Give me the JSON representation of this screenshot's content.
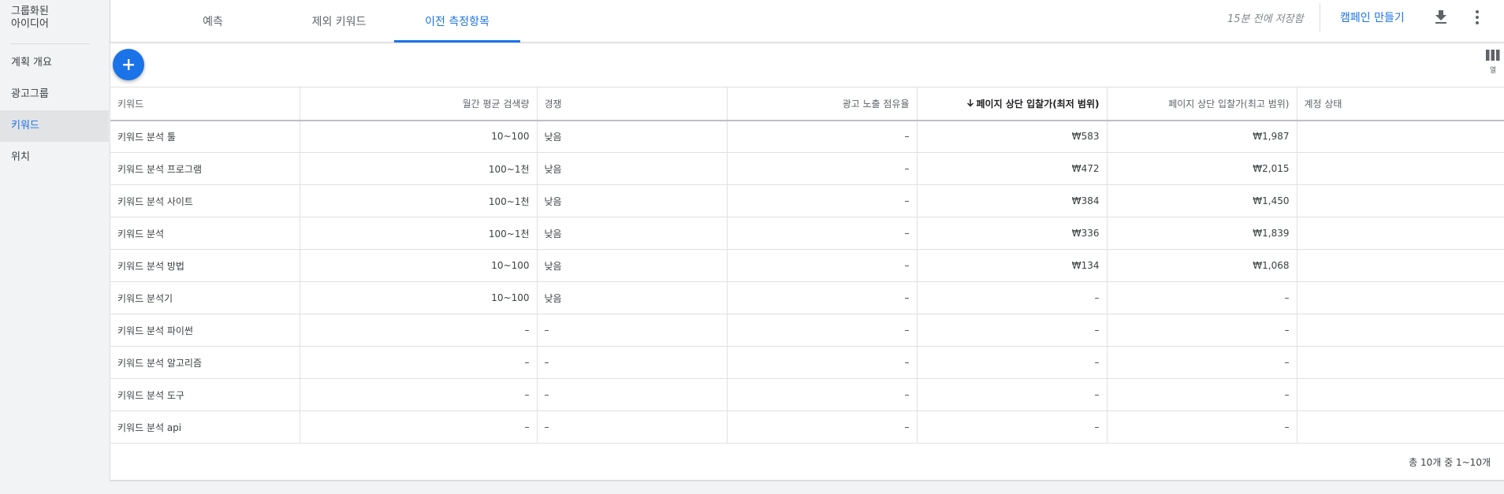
{
  "sidebar": {
    "group_title_line1": "그룹화된",
    "group_title_line2": "아이디어",
    "items": [
      {
        "label": "계획 개요",
        "active": false
      },
      {
        "label": "광고그룹",
        "active": false
      },
      {
        "label": "키워드",
        "active": true
      },
      {
        "label": "위치",
        "active": false
      }
    ]
  },
  "tabs": [
    {
      "label": "예측",
      "active": false
    },
    {
      "label": "제외 키워드",
      "active": false
    },
    {
      "label": "이전 측정항목",
      "active": true
    }
  ],
  "header": {
    "saved_status": "15분 전에 저장함",
    "create_campaign_label": "캠페인 만들기",
    "download_icon": "download-icon",
    "more_icon": "more-vert-icon"
  },
  "toolbar": {
    "add_icon": "plus-icon",
    "columns_label": "열"
  },
  "table": {
    "columns": [
      {
        "label": "키워드",
        "align": "left"
      },
      {
        "label": "월간 평균 검색량",
        "align": "right"
      },
      {
        "label": "경쟁",
        "align": "left"
      },
      {
        "label": "광고 노출 점유율",
        "align": "right"
      },
      {
        "label": "페이지 상단 입찰가(최저 범위)",
        "align": "right",
        "sorted": "desc"
      },
      {
        "label": "페이지 상단 입찰가(최고 범위)",
        "align": "right"
      },
      {
        "label": "계정 상태",
        "align": "left"
      }
    ],
    "rows": [
      [
        "키워드 분석 툴",
        "10~100",
        "낮음",
        "–",
        "₩583",
        "₩1,987",
        ""
      ],
      [
        "키워드 분석 프로그램",
        "100~1천",
        "낮음",
        "–",
        "₩472",
        "₩2,015",
        ""
      ],
      [
        "키워드 분석 사이트",
        "100~1천",
        "낮음",
        "–",
        "₩384",
        "₩1,450",
        ""
      ],
      [
        "키워드 분석",
        "100~1천",
        "낮음",
        "–",
        "₩336",
        "₩1,839",
        ""
      ],
      [
        "키워드 분석 방법",
        "10~100",
        "낮음",
        "–",
        "₩134",
        "₩1,068",
        ""
      ],
      [
        "키워드 분석기",
        "10~100",
        "낮음",
        "–",
        "–",
        "–",
        ""
      ],
      [
        "키워드 분석 파이썬",
        "–",
        "–",
        "–",
        "–",
        "–",
        ""
      ],
      [
        "키워드 분석 알고리즘",
        "–",
        "–",
        "–",
        "–",
        "–",
        ""
      ],
      [
        "키워드 분석 도구",
        "–",
        "–",
        "–",
        "–",
        "–",
        ""
      ],
      [
        "키워드 분석 api",
        "–",
        "–",
        "–",
        "–",
        "–",
        ""
      ]
    ]
  },
  "pagination": {
    "summary": "총 10개 중 1~10개"
  },
  "colors": {
    "accent": "#1a73e8",
    "sidebar_bg": "#f1f3f4",
    "active_item_bg": "#e2e3e5"
  }
}
